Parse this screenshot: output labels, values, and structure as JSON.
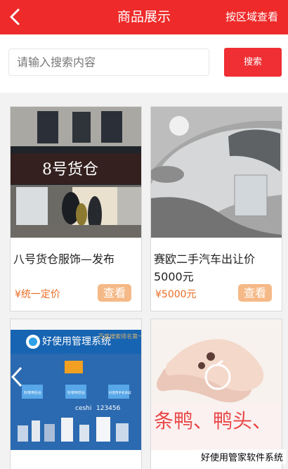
{
  "header": {
    "title": "商品展示",
    "region_link": "按区域查看"
  },
  "search": {
    "placeholder": "请输入搜索内容",
    "button": "搜索"
  },
  "products": [
    {
      "name": "八号货仓服饰—发布",
      "price": "¥统一定价",
      "button": "查看",
      "sign_text": "8号货仓"
    },
    {
      "name": "赛欧二手汽车出让价5000元",
      "price": "¥5000元",
      "button": "查看"
    },
    {
      "brand_title": "好使用管理系统",
      "subtitle": "百度搜索排名第一",
      "btns": [
        "好使用后台",
        "好使用前台",
        "好使用手机商城"
      ],
      "account": "ceshi",
      "password": "123456"
    },
    {
      "banner": "条鸭、鸭头、"
    }
  ],
  "footer": {
    "watermark": "好使用管家软件系统"
  },
  "colors": {
    "header": "#ee2a2a",
    "search_button": "#ef2f34",
    "accent_price": "#ea6d25",
    "view_button": "#f5b987"
  }
}
